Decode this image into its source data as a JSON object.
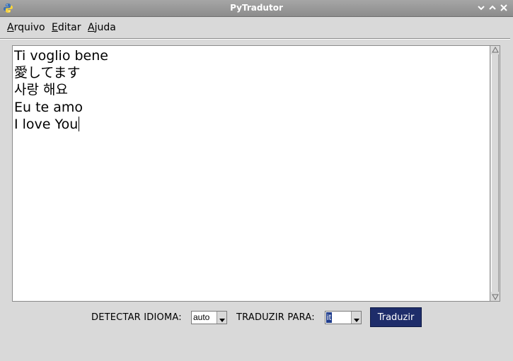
{
  "window": {
    "title": "PyTradutor"
  },
  "menu": {
    "items": [
      {
        "label_first": "A",
        "label_rest": "rquivo"
      },
      {
        "label_first": "E",
        "label_rest": "ditar"
      },
      {
        "label_first": "A",
        "label_rest": "juda"
      }
    ]
  },
  "editor": {
    "lines": [
      "Ti voglio bene",
      "愛してます",
      "사랑 해요",
      "Eu te amo",
      "I love You"
    ]
  },
  "controls": {
    "detect_label": "DETECTAR IDIOMA:",
    "detect_value": "auto",
    "translate_label": "TRADUZIR PARA:",
    "translate_value": "it",
    "translate_button": "Traduzir"
  },
  "colors": {
    "titlebar": "#999999",
    "button": "#1e2d6a",
    "selection": "#1f3c8c"
  }
}
